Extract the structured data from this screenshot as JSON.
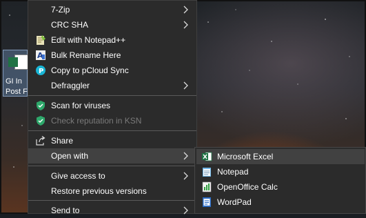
{
  "desktop": {
    "file_icon": {
      "name_line1": "GI In",
      "name_line2": "Post Fl"
    }
  },
  "context_menu": {
    "items": [
      {
        "label": "7-Zip",
        "icon": "none",
        "submenu": true
      },
      {
        "label": "CRC SHA",
        "icon": "none",
        "submenu": true
      },
      {
        "label": "Edit with Notepad++",
        "icon": "notepad-plus-plus-icon",
        "submenu": false
      },
      {
        "label": "Bulk Rename Here",
        "icon": "bulk-rename-icon",
        "submenu": false
      },
      {
        "label": "Copy to pCloud Sync",
        "icon": "pcloud-icon",
        "submenu": false
      },
      {
        "label": "Defraggler",
        "icon": "none",
        "submenu": true
      },
      {
        "label": "Scan for viruses",
        "icon": "shield-icon",
        "submenu": false
      },
      {
        "label": "Check reputation in KSN",
        "icon": "shield-icon",
        "submenu": false,
        "disabled": true
      },
      {
        "label": "Share",
        "icon": "share-icon",
        "submenu": false
      },
      {
        "label": "Open with",
        "icon": "none",
        "submenu": true,
        "highlighted": true
      },
      {
        "label": "Give access to",
        "icon": "none",
        "submenu": true
      },
      {
        "label": "Restore previous versions",
        "icon": "none",
        "submenu": false
      },
      {
        "label": "Send to",
        "icon": "none",
        "submenu": true
      }
    ]
  },
  "open_with_submenu": {
    "items": [
      {
        "label": "Microsoft Excel",
        "icon": "excel-icon",
        "highlighted": true
      },
      {
        "label": "Notepad",
        "icon": "notepad-icon"
      },
      {
        "label": "OpenOffice Calc",
        "icon": "openoffice-calc-icon"
      },
      {
        "label": "WordPad",
        "icon": "wordpad-icon"
      }
    ]
  },
  "colors": {
    "menu_bg": "#2b2b2b",
    "menu_hover": "#414141",
    "separator": "#5a5a5a",
    "text": "#ffffff",
    "disabled_text": "#7a7a7a",
    "shield_green": "#2ea86b",
    "excel_green": "#1f7244"
  }
}
